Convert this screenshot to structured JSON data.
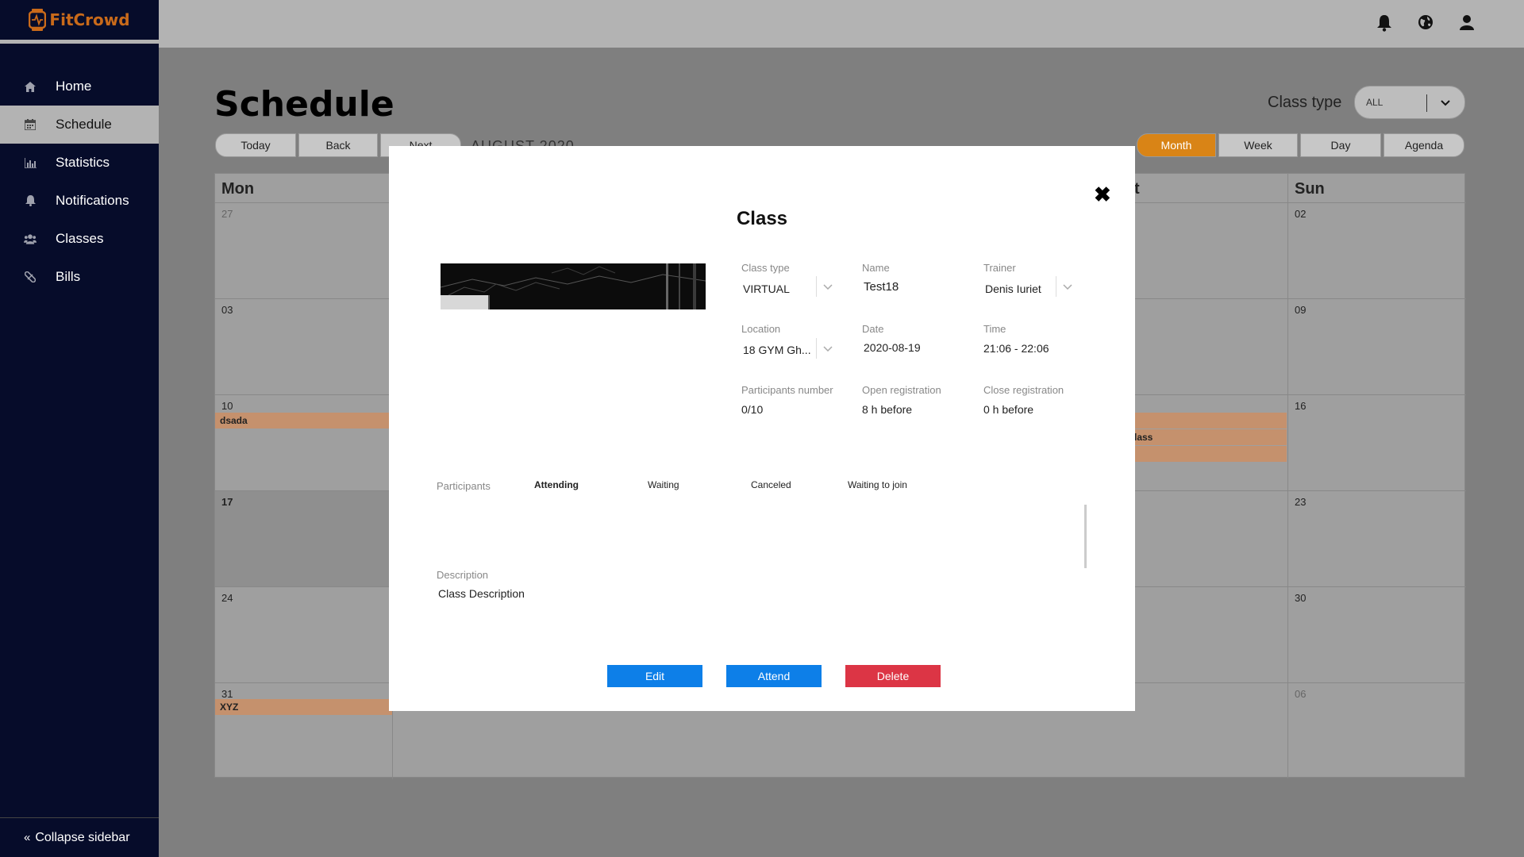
{
  "app": {
    "name": "FitCrowd",
    "brand_color": "#c96a1a"
  },
  "sidebar": {
    "items": [
      {
        "label": "Home",
        "icon": "home-icon"
      },
      {
        "label": "Schedule",
        "icon": "calendar-icon",
        "active": true
      },
      {
        "label": "Statistics",
        "icon": "bar-chart-icon"
      },
      {
        "label": "Notifications",
        "icon": "bell-icon"
      },
      {
        "label": "Classes",
        "icon": "users-icon"
      },
      {
        "label": "Bills",
        "icon": "pill-icon"
      }
    ],
    "collapse_label": "Collapse sidebar"
  },
  "topbar": {
    "icons": [
      "bell-icon",
      "globe-icon",
      "user-icon"
    ]
  },
  "main": {
    "title": "Schedule",
    "class_type_label": "Class type",
    "class_type_value": "ALL",
    "toolbar": {
      "today": "Today",
      "back": "Back",
      "next": "Next",
      "month_label": "AUGUST 2020"
    },
    "views": [
      "Month",
      "Week",
      "Day",
      "Agenda"
    ],
    "active_view": "Month",
    "accent_color": "#d98416"
  },
  "calendar": {
    "headers": {
      "mon": "Mon",
      "sat_partial": "t",
      "sun": "Sun"
    },
    "weeks": [
      {
        "mon": "27",
        "sun": "02"
      },
      {
        "mon": "03",
        "sun": "09"
      },
      {
        "mon": "10",
        "sun": "16"
      },
      {
        "mon": "17",
        "sun": "23"
      },
      {
        "mon": "24",
        "sun": "30"
      },
      {
        "mon": "31",
        "sun": "06"
      }
    ],
    "events": {
      "dsada": "dsada",
      "class_partial": "lass",
      "xyz": "XYZ"
    }
  },
  "modal": {
    "title": "Class",
    "fields": {
      "class_type": {
        "label": "Class type",
        "value": "VIRTUAL"
      },
      "name": {
        "label": "Name",
        "value": "Test18"
      },
      "trainer": {
        "label": "Trainer",
        "value": "Denis Iuriet"
      },
      "location": {
        "label": "Location",
        "value": "18 GYM Gh..."
      },
      "date": {
        "label": "Date",
        "value": "2020-08-19"
      },
      "time": {
        "label": "Time",
        "value": "21:06 - 22:06"
      },
      "participants_number": {
        "label": "Participants number",
        "value": "0/10"
      },
      "open_registration": {
        "label": "Open registration",
        "value": "8 h before"
      },
      "close_registration": {
        "label": "Close registration",
        "value": "0 h before"
      }
    },
    "participants_label": "Participants",
    "tabs": [
      "Attending",
      "Waiting",
      "Canceled",
      "Waiting to join"
    ],
    "description_label": "Description",
    "description_value": "Class Description",
    "buttons": {
      "edit": "Edit",
      "attend": "Attend",
      "delete": "Delete"
    },
    "button_colors": {
      "edit": "#0d7fe8",
      "attend": "#0d7fe8",
      "delete": "#dc3545"
    }
  }
}
